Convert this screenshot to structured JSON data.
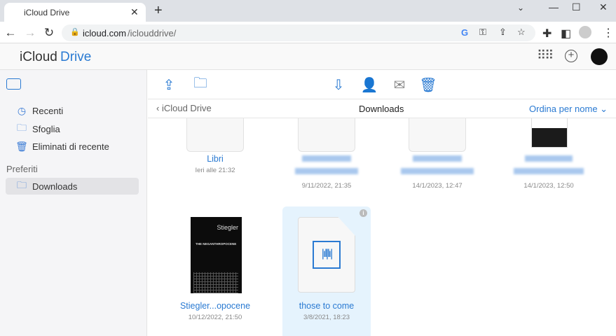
{
  "browser": {
    "tab_title": "iCloud Drive",
    "url_host": "icloud.com",
    "url_path": "/iclouddrive/"
  },
  "app": {
    "logo_prefix": "iCloud",
    "logo_suffix": "Drive"
  },
  "sidebar": {
    "items": [
      {
        "label": "Recenti",
        "icon": "clock-icon"
      },
      {
        "label": "Sfoglia",
        "icon": "folder-icon"
      },
      {
        "label": "Eliminati di recente",
        "icon": "trash-icon"
      }
    ],
    "section_label": "Preferiti",
    "favorites": [
      {
        "label": "Downloads",
        "icon": "folder-icon",
        "selected": true
      }
    ]
  },
  "breadcrumb": {
    "back_label": "iCloud Drive",
    "title": "Downloads",
    "sort_label": "Ordina per nome"
  },
  "files": [
    {
      "name": "Libri",
      "date": "Ieri alle 21:32",
      "type": "folder"
    },
    {
      "name": "",
      "date": "9/11/2022, 21:35",
      "type": "folder",
      "blurred": true
    },
    {
      "name": "",
      "date": "14/1/2023, 12:47",
      "type": "folder",
      "blurred": true
    },
    {
      "name": "",
      "date": "14/1/2023, 12:50",
      "type": "image",
      "blurred": true
    },
    {
      "name": "Stiegler...opocene",
      "date": "10/12/2022, 21:50",
      "type": "book",
      "cover_author": "Stiegler",
      "cover_title": "THE NEGANTHROPOCENE"
    },
    {
      "name": "those to come",
      "date": "3/8/2021, 18:23",
      "type": "audio",
      "selected": true
    }
  ],
  "colors": {
    "accent": "#2a7ad2",
    "selected_bg": "#e5f3fd"
  }
}
